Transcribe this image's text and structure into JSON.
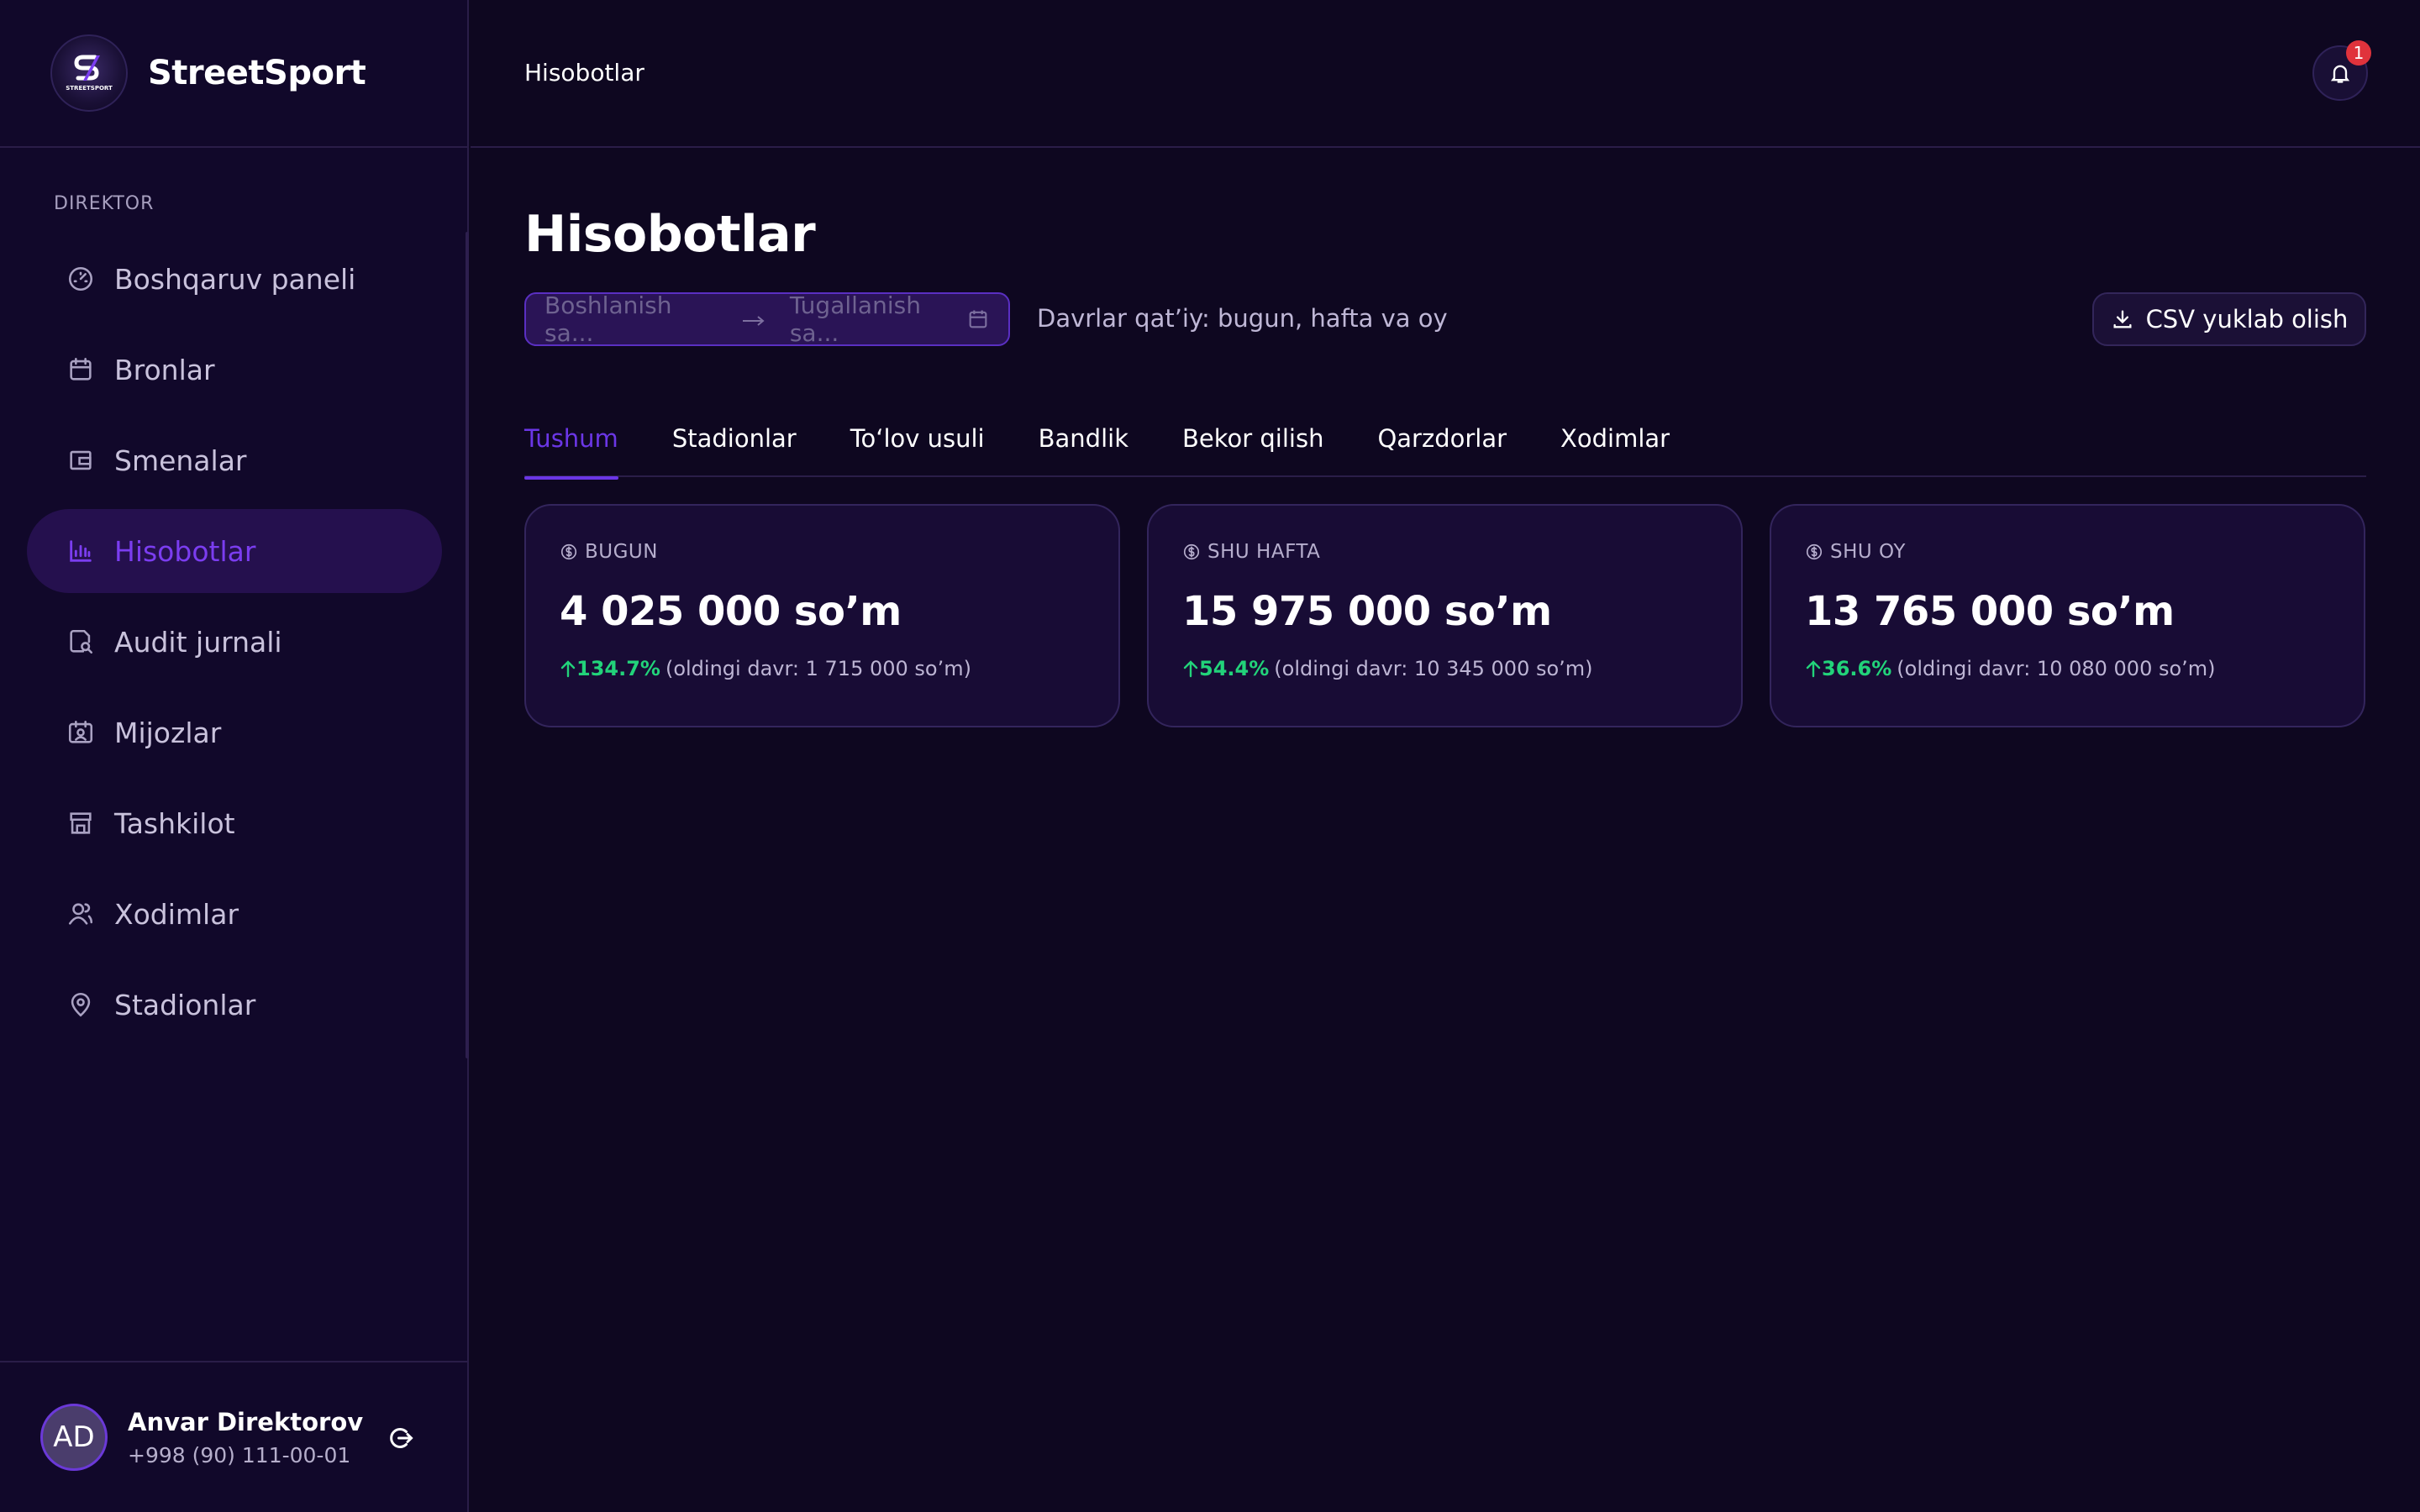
{
  "app": {
    "brand": "StreetSport",
    "logo_text": "STREETSPORT"
  },
  "sidebar": {
    "section_label": "DIREKTOR",
    "items": [
      {
        "label": "Boshqaruv paneli",
        "icon": "dashboard-gauge-icon",
        "active": false
      },
      {
        "label": "Bronlar",
        "icon": "calendar-icon",
        "active": false
      },
      {
        "label": "Smenalar",
        "icon": "wallet-icon",
        "active": false
      },
      {
        "label": "Hisobotlar",
        "icon": "bar-chart-icon",
        "active": true
      },
      {
        "label": "Audit jurnali",
        "icon": "document-search-icon",
        "active": false
      },
      {
        "label": "Mijozlar",
        "icon": "calendar-user-icon",
        "active": false
      },
      {
        "label": "Tashkilot",
        "icon": "store-icon",
        "active": false
      },
      {
        "label": "Xodimlar",
        "icon": "users-icon",
        "active": false
      },
      {
        "label": "Stadionlar",
        "icon": "map-pin-icon",
        "active": false
      }
    ],
    "user": {
      "initials": "AD",
      "name": "Anvar Direktorov",
      "phone": "+998 (90) 111-00-01"
    }
  },
  "topbar": {
    "title": "Hisobotlar",
    "notification_count": "1"
  },
  "main": {
    "title": "Hisobotlar",
    "date_range": {
      "start_placeholder": "Boshlanish sa...",
      "end_placeholder": "Tugallanish sa..."
    },
    "period_note": "Davrlar qat’iy: bugun, hafta va oy",
    "csv_button": "CSV yuklab olish",
    "tabs": [
      {
        "label": "Tushum",
        "active": true
      },
      {
        "label": "Stadionlar",
        "active": false
      },
      {
        "label": "To‘lov usuli",
        "active": false
      },
      {
        "label": "Bandlik",
        "active": false
      },
      {
        "label": "Bekor qilish",
        "active": false
      },
      {
        "label": "Qarzdorlar",
        "active": false
      },
      {
        "label": "Xodimlar",
        "active": false
      }
    ],
    "cards": [
      {
        "label": "BUGUN",
        "value": "4 025 000 so’m",
        "delta": "134.7%",
        "previous": "(oldingi davr: 1 715 000 so’m)"
      },
      {
        "label": "SHU HAFTA",
        "value": "15 975 000 so’m",
        "delta": "54.4%",
        "previous": "(oldingi davr: 10 345 000 so’m)"
      },
      {
        "label": "SHU OY",
        "value": "13 765 000 so’m",
        "delta": "36.6%",
        "previous": "(oldingi davr: 10 080 000 so’m)"
      }
    ]
  },
  "colors": {
    "background": "#0e0720",
    "sidebar": "#11082a",
    "accent": "#6b36e6",
    "positive": "#22d37a",
    "badge": "#e0333c"
  }
}
